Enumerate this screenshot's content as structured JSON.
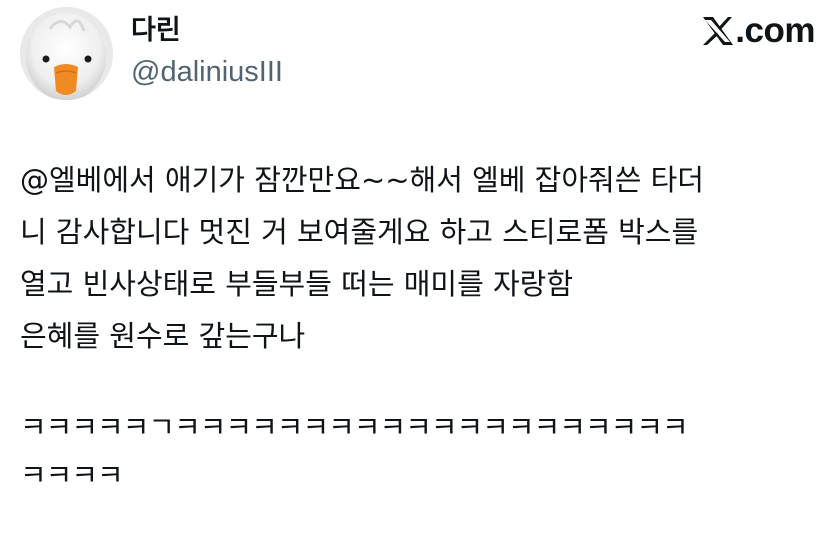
{
  "author": {
    "display_name": "다린",
    "handle": "@daliniusIII",
    "avatar_icon": "duck-avatar-icon"
  },
  "brand": {
    "logo_icon": "x-logo-icon",
    "label": ".com"
  },
  "tweet": {
    "body_lines": [
      "@엘베에서 애기가 잠깐만요~~해서 엘베 잡아줘쓴 타더",
      "니 감사합니다 멋진 거 보여줄게요 하고 스티로폼 박스를",
      "열고 빈사상태로 부들부들 떠는 매미를 자랑함",
      "은혜를 원수로 갚는구나"
    ],
    "laugh_lines": [
      "ㅋㅋㅋㅋㅋㄱㅋㅋㅋㅋㅋㅋㅋㅋㅋㅋㅋㅋㅋㅋㅋㅋㅋㅋㅋㅋ",
      "ㅋㅋㅋㅋ"
    ]
  },
  "colors": {
    "text_primary": "#0f1419",
    "text_secondary": "#536471",
    "background": "#ffffff",
    "avatar_beak": "#f08a24"
  }
}
